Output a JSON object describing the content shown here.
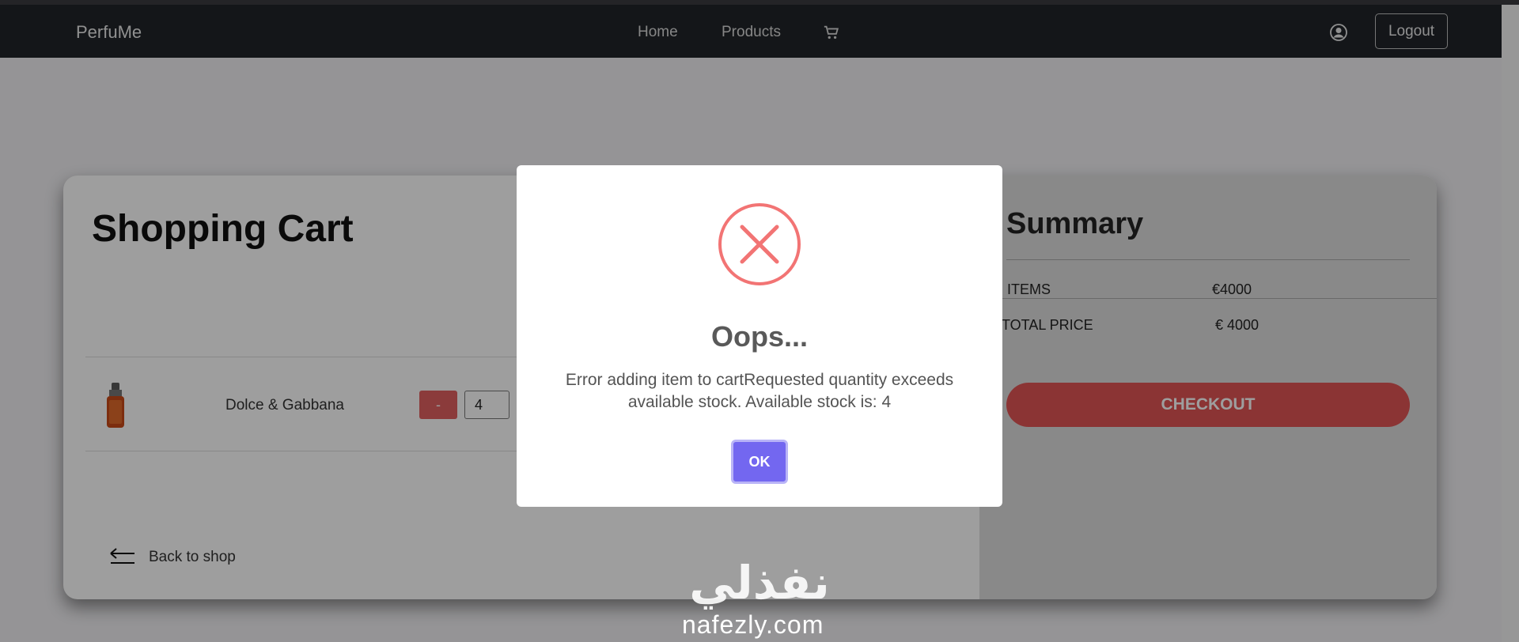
{
  "navbar": {
    "brand": "PerfuMe",
    "links": [
      "Home",
      "Products"
    ],
    "cart_icon": "cart-icon",
    "user_icon": "user-circle-icon",
    "logout_label": "Logout"
  },
  "cart": {
    "title": "Shopping Cart",
    "items": [
      {
        "name": "Dolce & Gabbana",
        "minus_label": "-",
        "quantity": "4"
      }
    ],
    "back_label": "Back to shop"
  },
  "summary": {
    "title": "Summary",
    "rows": [
      {
        "label": "ITEMS",
        "value": "€4000"
      },
      {
        "label": "TOTAL PRICE",
        "value": "€ 4000"
      }
    ],
    "checkout_label": "CHECKOUT"
  },
  "modal": {
    "icon": "error-x-icon",
    "title": "Oops...",
    "message": "Error adding item to cartRequested quantity exceeds available stock. Available stock is: 4",
    "ok_label": "OK"
  },
  "watermark": {
    "arabic": "نفذلي",
    "latin": "nafezly.com"
  },
  "colors": {
    "navbar": "#212529",
    "accent_red": "#e05454",
    "error_icon": "#f27474",
    "ok_button": "#7367f0"
  }
}
